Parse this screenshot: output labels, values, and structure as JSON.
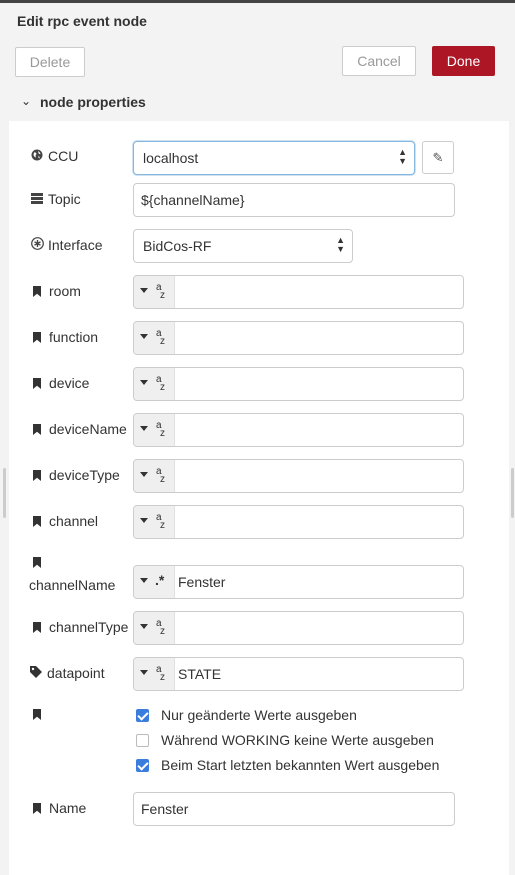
{
  "dialog": {
    "title": "Edit rpc event node"
  },
  "toolbar": {
    "delete_label": "Delete",
    "cancel_label": "Cancel",
    "done_label": "Done"
  },
  "section": {
    "title": "node properties"
  },
  "fields": {
    "ccu": {
      "label": "CCU",
      "value": "localhost"
    },
    "topic": {
      "label": "Topic",
      "value": "${channelName}"
    },
    "interface": {
      "label": "Interface",
      "value": "BidCos-RF"
    },
    "room": {
      "label": "room",
      "value": ""
    },
    "function": {
      "label": "function",
      "value": ""
    },
    "device": {
      "label": "device",
      "value": ""
    },
    "deviceName": {
      "label": "deviceName",
      "value": ""
    },
    "deviceType": {
      "label": "deviceType",
      "value": ""
    },
    "channel": {
      "label": "channel",
      "value": ""
    },
    "channelName": {
      "label": "channelName",
      "value": "Fenster"
    },
    "channelType": {
      "label": "channelType",
      "value": ""
    },
    "datapoint": {
      "label": "datapoint",
      "value": "STATE"
    },
    "name": {
      "label": "Name",
      "value": "Fenster"
    }
  },
  "options": [
    {
      "label": "Nur geänderte Werte ausgeben",
      "checked": true
    },
    {
      "label": "Während WORKING keine Werte ausgeben",
      "checked": false
    },
    {
      "label": "Beim Start letzten bekannten Wert ausgeben",
      "checked": true
    }
  ],
  "colors": {
    "done_button": "#ad1625",
    "checkbox_checked": "#3b7ddd"
  }
}
